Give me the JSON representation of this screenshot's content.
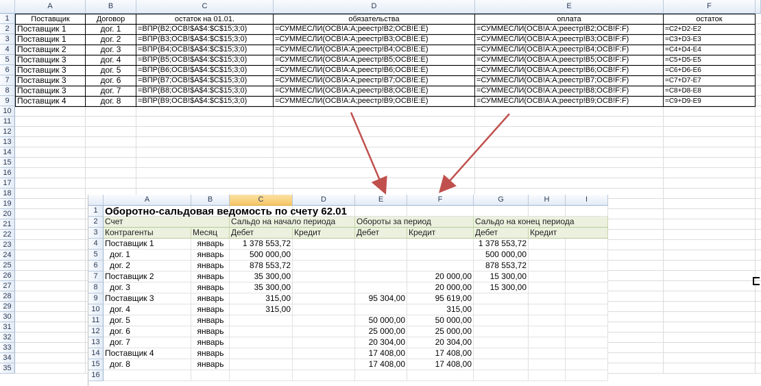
{
  "main": {
    "columns": [
      {
        "letter": "A",
        "label": "Поставщик"
      },
      {
        "letter": "B",
        "label": "Договор"
      },
      {
        "letter": "C",
        "label": "остаток на 01.01."
      },
      {
        "letter": "D",
        "label": "обязательства"
      },
      {
        "letter": "E",
        "label": "оплата"
      },
      {
        "letter": "F",
        "label": "остаток"
      }
    ],
    "row_numbers": [
      "1",
      "2",
      "3",
      "4",
      "5",
      "6",
      "7",
      "8",
      "9",
      "10",
      "11",
      "12",
      "13",
      "14",
      "15",
      "16",
      "17",
      "18",
      "19",
      "20",
      "21",
      "22",
      "23",
      "24",
      "25",
      "26",
      "27",
      "28",
      "29",
      "30",
      "31",
      "32",
      "33",
      "34",
      "35"
    ],
    "rows": [
      [
        "Поставщик 1",
        "дог. 1",
        "=ВПР(B2;ОСВ!$A$4:$C$15;3;0)",
        "=СУММЕСЛИ(ОСВ!A:A;реестр!B2;ОСВ!E:E)",
        "=СУММЕСЛИ(ОСВ!A:A;реестр!B2;ОСВ!F:F)",
        "=C2+D2-E2"
      ],
      [
        "Поставщик 1",
        "дог. 2",
        "=ВПР(B3;ОСВ!$A$4:$C$15;3;0)",
        "=СУММЕСЛИ(ОСВ!A:A;реестр!B3;ОСВ!E:E)",
        "=СУММЕСЛИ(ОСВ!A:A;реестр!B3;ОСВ!F:F)",
        "=C3+D3-E3"
      ],
      [
        "Поставщик 2",
        "дог. 3",
        "=ВПР(B4;ОСВ!$A$4:$C$15;3;0)",
        "=СУММЕСЛИ(ОСВ!A:A;реестр!B4;ОСВ!E:E)",
        "=СУММЕСЛИ(ОСВ!A:A;реестр!B4;ОСВ!F:F)",
        "=C4+D4-E4"
      ],
      [
        "Поставщик 3",
        "дог. 4",
        "=ВПР(B5;ОСВ!$A$4:$C$15;3;0)",
        "=СУММЕСЛИ(ОСВ!A:A;реестр!B5;ОСВ!E:E)",
        "=СУММЕСЛИ(ОСВ!A:A;реестр!B5;ОСВ!F:F)",
        "=C5+D5-E5"
      ],
      [
        "Поставщик 3",
        "дог. 5",
        "=ВПР(B6;ОСВ!$A$4:$C$15;3;0)",
        "=СУММЕСЛИ(ОСВ!A:A;реестр!B6;ОСВ!E:E)",
        "=СУММЕСЛИ(ОСВ!A:A;реестр!B6;ОСВ!F:F)",
        "=C6+D6-E6"
      ],
      [
        "Поставщик 3",
        "дог. 6",
        "=ВПР(B7;ОСВ!$A$4:$C$15;3;0)",
        "=СУММЕСЛИ(ОСВ!A:A;реестр!B7;ОСВ!E:E)",
        "=СУММЕСЛИ(ОСВ!A:A;реестр!B7;ОСВ!F:F)",
        "=C7+D7-E7"
      ],
      [
        "Поставщик 3",
        "дог. 7",
        "=ВПР(B8;ОСВ!$A$4:$C$15;3;0)",
        "=СУММЕСЛИ(ОСВ!A:A;реестр!B8;ОСВ!E:E)",
        "=СУММЕСЛИ(ОСВ!A:A;реестр!B8;ОСВ!F:F)",
        "=C8+D8-E8"
      ],
      [
        "Поставщик 4",
        "дог. 8",
        "=ВПР(B9;ОСВ!$A$4:$C$15;3;0)",
        "=СУММЕСЛИ(ОСВ!A:A;реестр!B9;ОСВ!E:E)",
        "=СУММЕСЛИ(ОСВ!A:A;реестр!B9;ОСВ!F:F)",
        "=C9+D9-E9"
      ]
    ]
  },
  "osv": {
    "columns": [
      "A",
      "B",
      "C",
      "D",
      "E",
      "F",
      "G",
      "H",
      "I"
    ],
    "row_numbers": [
      "1",
      "2",
      "3",
      "4",
      "5",
      "6",
      "7",
      "8",
      "9",
      "10",
      "11",
      "12",
      "13",
      "14",
      "15",
      "16"
    ],
    "title": "Оборотно-сальдовая ведомость по счету 62.01",
    "hdr_account": "Счет",
    "hdr_open": "Сальдо на начало периода",
    "hdr_turn": "Обороты за период",
    "hdr_close": "Сальдо на конец периода",
    "hdr_contr": "Контрагенты",
    "hdr_month": "Месяц",
    "debit": "Дебет",
    "credit": "Кредит",
    "rows": [
      {
        "name": "Поставщик 1",
        "month": "январь",
        "c": "1 378 553,72",
        "d": "",
        "e": "",
        "f": "",
        "g": "1 378 553,72"
      },
      {
        "name": "дог. 1",
        "month": "январь",
        "c": "500 000,00",
        "d": "",
        "e": "",
        "f": "",
        "g": "500 000,00"
      },
      {
        "name": "дог. 2",
        "month": "январь",
        "c": "878 553,72",
        "d": "",
        "e": "",
        "f": "",
        "g": "878 553,72"
      },
      {
        "name": "Поставщик 2",
        "month": "январь",
        "c": "35 300,00",
        "d": "",
        "e": "",
        "f": "20 000,00",
        "g": "15 300,00"
      },
      {
        "name": "дог. 3",
        "month": "январь",
        "c": "35 300,00",
        "d": "",
        "e": "",
        "f": "20 000,00",
        "g": "15 300,00"
      },
      {
        "name": "Поставщик 3",
        "month": "январь",
        "c": "315,00",
        "d": "",
        "e": "95 304,00",
        "f": "95 619,00",
        "g": ""
      },
      {
        "name": "дог. 4",
        "month": "январь",
        "c": "315,00",
        "d": "",
        "e": "",
        "f": "315,00",
        "g": ""
      },
      {
        "name": "дог. 5",
        "month": "январь",
        "c": "",
        "d": "",
        "e": "50 000,00",
        "f": "50 000,00",
        "g": ""
      },
      {
        "name": "дог. 6",
        "month": "январь",
        "c": "",
        "d": "",
        "e": "25 000,00",
        "f": "25 000,00",
        "g": ""
      },
      {
        "name": "дог. 7",
        "month": "январь",
        "c": "",
        "d": "",
        "e": "20 304,00",
        "f": "20 304,00",
        "g": ""
      },
      {
        "name": "Поставщик 4",
        "month": "январь",
        "c": "",
        "d": "",
        "e": "17 408,00",
        "f": "17 408,00",
        "g": ""
      },
      {
        "name": "дог. 8",
        "month": "январь",
        "c": "",
        "d": "",
        "e": "17 408,00",
        "f": "17 408,00",
        "g": ""
      }
    ]
  }
}
